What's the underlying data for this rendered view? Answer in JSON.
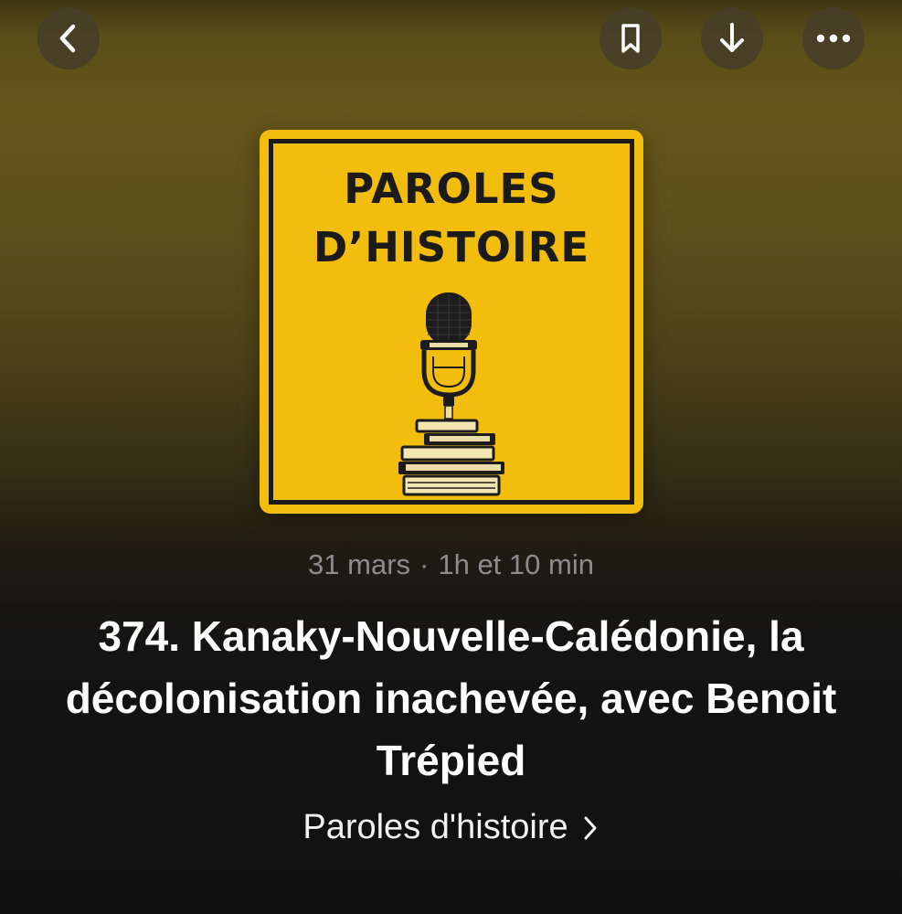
{
  "header": {
    "back_icon": "chevron-left-icon",
    "bookmark_icon": "bookmark-icon",
    "download_icon": "download-arrow-icon",
    "more_icon": "ellipsis-icon"
  },
  "artwork": {
    "line1": "PAROLES",
    "line2": "D’HISTOIRE",
    "background_color": "#f3bd0e",
    "illustration": "microphone-on-books"
  },
  "episode": {
    "date": "31 mars",
    "separator": "·",
    "duration": "1h et 10 min",
    "title": "374. Kanaky-Nouvelle-Calédonie, la décolonisation inachevée, avec Benoit Trépied"
  },
  "show": {
    "name": "Paroles d'histoire",
    "chevron_icon": "chevron-right-icon"
  }
}
